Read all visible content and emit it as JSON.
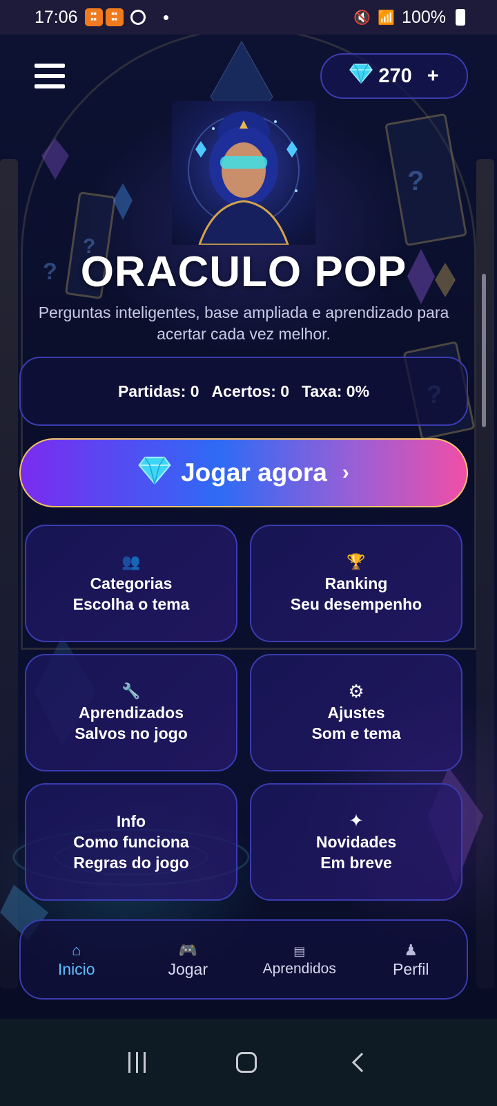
{
  "status_bar": {
    "time": "17:06",
    "notification_icons": [
      "temu-icon",
      "temu-icon",
      "sync-icon"
    ],
    "battery": "100%"
  },
  "header": {
    "gems": "270",
    "add": "+"
  },
  "app": {
    "title": "ORACULO POP",
    "subtitle": "Perguntas inteligentes, base ampliada e aprendizado para acertar cada vez melhor."
  },
  "stats": {
    "matches": "Partidas: 0",
    "hits": "Acertos: 0",
    "rate": "Taxa: 0%"
  },
  "play_button": {
    "label": "Jogar agora",
    "chevron": "›"
  },
  "tiles": {
    "categories": {
      "icon": "👥",
      "line1": "Categorias",
      "line2": "Escolha o tema"
    },
    "ranking": {
      "icon": "🏆",
      "line1": "Ranking",
      "line2": "Seu desempenho"
    },
    "learned": {
      "icon": "🔧",
      "line1": "Aprendizados",
      "line2": "Salvos no jogo"
    },
    "settings": {
      "icon": "⚙",
      "line1": "Ajustes",
      "line2": "Som e tema"
    },
    "info": {
      "line1": "Info",
      "line2": "Como funciona",
      "line3": "Regras do jogo"
    },
    "news": {
      "icon": "✦",
      "line1": "Novidades",
      "line2": "Em breve"
    }
  },
  "bottom_nav": [
    {
      "icon": "⌂",
      "label": "Inicio",
      "active": true
    },
    {
      "icon": "🎮",
      "label": "Jogar",
      "active": false
    },
    {
      "icon": "▤",
      "label": "Aprendidos",
      "active": false
    },
    {
      "icon": "♟",
      "label": "Perfil",
      "active": false
    }
  ],
  "colors": {
    "accent": "#5fc0ff",
    "card_border": "#3a3cb0",
    "play_gradient_start": "#7a2cf0",
    "play_gradient_end": "#f04fa6"
  }
}
